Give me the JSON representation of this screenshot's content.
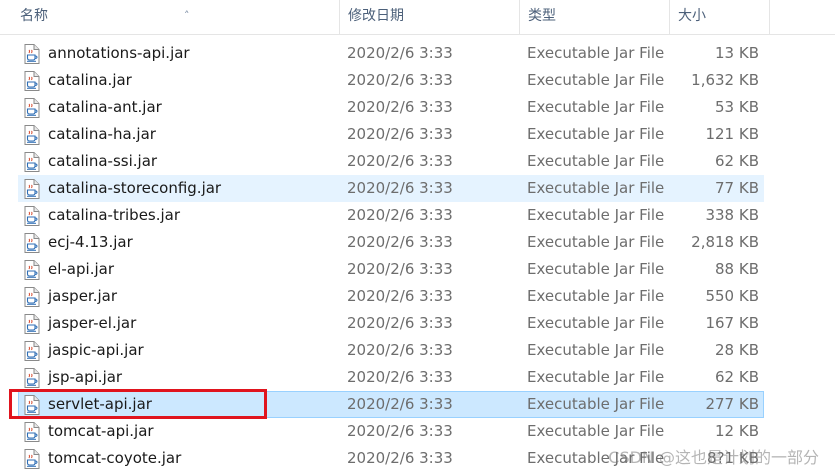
{
  "columns": {
    "name": "名称",
    "date": "修改日期",
    "type": "类型",
    "size": "大小"
  },
  "files": [
    {
      "name": "annotations-api.jar",
      "date": "2020/2/6 3:33",
      "type": "Executable Jar File",
      "size": "13 KB"
    },
    {
      "name": "catalina.jar",
      "date": "2020/2/6 3:33",
      "type": "Executable Jar File",
      "size": "1,632 KB"
    },
    {
      "name": "catalina-ant.jar",
      "date": "2020/2/6 3:33",
      "type": "Executable Jar File",
      "size": "53 KB"
    },
    {
      "name": "catalina-ha.jar",
      "date": "2020/2/6 3:33",
      "type": "Executable Jar File",
      "size": "121 KB"
    },
    {
      "name": "catalina-ssi.jar",
      "date": "2020/2/6 3:33",
      "type": "Executable Jar File",
      "size": "62 KB"
    },
    {
      "name": "catalina-storeconfig.jar",
      "date": "2020/2/6 3:33",
      "type": "Executable Jar File",
      "size": "77 KB",
      "state": "hover"
    },
    {
      "name": "catalina-tribes.jar",
      "date": "2020/2/6 3:33",
      "type": "Executable Jar File",
      "size": "338 KB"
    },
    {
      "name": "ecj-4.13.jar",
      "date": "2020/2/6 3:33",
      "type": "Executable Jar File",
      "size": "2,818 KB"
    },
    {
      "name": "el-api.jar",
      "date": "2020/2/6 3:33",
      "type": "Executable Jar File",
      "size": "88 KB"
    },
    {
      "name": "jasper.jar",
      "date": "2020/2/6 3:33",
      "type": "Executable Jar File",
      "size": "550 KB"
    },
    {
      "name": "jasper-el.jar",
      "date": "2020/2/6 3:33",
      "type": "Executable Jar File",
      "size": "167 KB"
    },
    {
      "name": "jaspic-api.jar",
      "date": "2020/2/6 3:33",
      "type": "Executable Jar File",
      "size": "28 KB"
    },
    {
      "name": "jsp-api.jar",
      "date": "2020/2/6 3:33",
      "type": "Executable Jar File",
      "size": "62 KB"
    },
    {
      "name": "servlet-api.jar",
      "date": "2020/2/6 3:33",
      "type": "Executable Jar File",
      "size": "277 KB",
      "state": "selected"
    },
    {
      "name": "tomcat-api.jar",
      "date": "2020/2/6 3:33",
      "type": "Executable Jar File",
      "size": "12 KB"
    },
    {
      "name": "tomcat-coyote.jar",
      "date": "2020/2/6 3:33",
      "type": "Executable Jar File",
      "size": "8?1 KB"
    }
  ],
  "watermark": "CSDN @这也是计划的一部分",
  "colors": {
    "hover_bg": "#e5f3ff",
    "selected_bg": "#cce8ff",
    "selected_border": "#99d1ff",
    "annotation_box": "#e0141e"
  },
  "icons": {
    "file": "java-jar-file-icon",
    "sort": "sort-ascending-icon"
  }
}
